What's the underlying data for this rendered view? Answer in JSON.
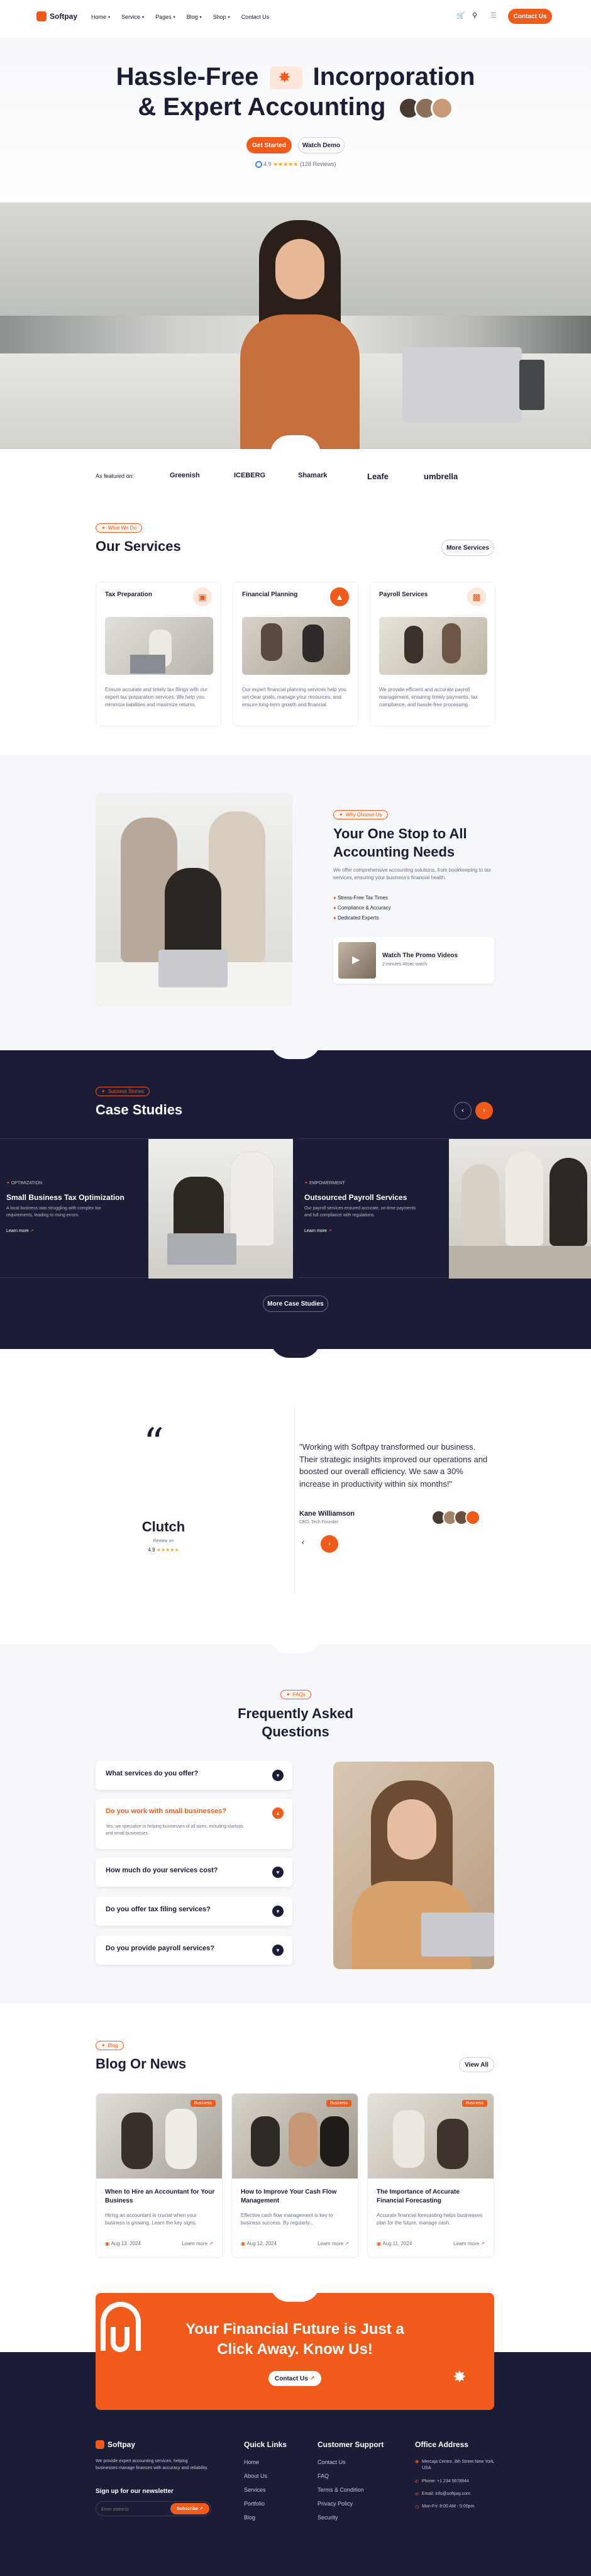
{
  "header": {
    "logo": "Softpay",
    "nav": [
      {
        "label": "Home"
      },
      {
        "label": "Service"
      },
      {
        "label": "Pages"
      },
      {
        "label": "Blog"
      },
      {
        "label": "Shop"
      },
      {
        "label": "Contact Us"
      }
    ],
    "cta": "Contact Us"
  },
  "hero": {
    "title_line1_a": "Hassle-Free",
    "title_line1_b": "Incorporation",
    "title_line2": "& Expert Accounting",
    "primary_btn": "Get Started",
    "secondary_btn": "Watch Demo",
    "rating_value": "4.9",
    "stars": "★★★★★",
    "reviews": "(128 Reviews)"
  },
  "featured": {
    "label": "As featured on:",
    "brands": [
      "Greenish",
      "ICEBERG",
      "Shamark",
      "Leafe",
      "umbrella"
    ]
  },
  "services": {
    "tag": "What We Do",
    "title": "Our Services",
    "more": "More Services",
    "cards": [
      {
        "title": "Tax Preparation",
        "desc": "Ensure accurate and timely tax filings with our expert tax preparation services. We help you minimize liabilities and maximize returns."
      },
      {
        "title": "Financial Planning",
        "desc": "Our expert financial planning services help you set clear goals, manage your resources, and ensure long-term growth and financial."
      },
      {
        "title": "Payroll Services",
        "desc": "We provide efficient and accurate payroll management, ensuring timely payments, tax compliance, and hassle-free processing."
      }
    ]
  },
  "about": {
    "tag": "Why Choose Us",
    "title_line1": "Your One Stop to All",
    "title_line2": "Accounting Needs",
    "desc": "We offer comprehensive accounting solutions, from bookkeeping to tax services, ensuring your business's financial health.",
    "features": [
      "Stress-Free Tax Times",
      "Compliance & Accuracy",
      "Dedicated Experts"
    ],
    "promo_title": "Watch The Promo Videos",
    "promo_sub": "2 minutes 48sec watch"
  },
  "cases": {
    "tag": "Success Stories",
    "title": "Case Studies",
    "items": [
      {
        "category": "OPTIMIZATION",
        "title": "Small Business Tax Optimization",
        "desc": "A local business was struggling with complex tax requirements, leading to rising errors.",
        "link": "Learn more"
      },
      {
        "category": "EMPOWERMENT",
        "title": "Outsourced Payroll Services",
        "desc": "Our payroll services ensured accurate, on-time payments and full compliance with regulations.",
        "link": "Learn more"
      }
    ],
    "more": "More Case Studies"
  },
  "testimonial": {
    "quote": "\"Working with Softpay transformed our business. Their strategic insights improved our operations and boosted our overall efficiency. We saw a 30% increase in productivity within six months!\"",
    "name": "Kane Williamson",
    "role": "CEO, Tech Founder",
    "brand": "Clutch",
    "brand_sub": "Review on",
    "brand_rating": "4.9",
    "brand_stars": "★★★★★"
  },
  "faq": {
    "tag": "FAQs",
    "title_line1": "Frequently Asked",
    "title_line2": "Questions",
    "items": [
      {
        "q": "What services do you offer?"
      },
      {
        "q": "Do you work with small businesses?",
        "a": "Yes, we specialize in helping businesses of all sizes, including startups and small businesses."
      },
      {
        "q": "How much do your services cost?"
      },
      {
        "q": "Do you offer tax filing services?"
      },
      {
        "q": "Do you provide payroll services?"
      }
    ]
  },
  "blog": {
    "tag": "Blog",
    "title": "Blog Or News",
    "view_all": "View All",
    "posts": [
      {
        "badge": "Business",
        "title": "When to Hire an Accountant for Your Business",
        "desc": "Hiring an accountant is crucial when your business is growing. Learn the key signs.",
        "date": "Aug 13, 2024",
        "link": "Learn more"
      },
      {
        "badge": "Business",
        "title": "How to Improve Your Cash Flow Management",
        "desc": "Effective cash flow management is key to business success. By regularly...",
        "date": "Aug 12, 2024",
        "link": "Learn more"
      },
      {
        "badge": "Business",
        "title": "The Importance of Accurate Financial Forecasting",
        "desc": "Accurate financial forecasting helps businesses plan for the future, manage cash.",
        "date": "Aug 11, 2024",
        "link": "Learn more"
      }
    ]
  },
  "cta": {
    "line1": "Your Financial Future is Just a",
    "line2": "Click Away. Know Us!",
    "btn": "Contact Us"
  },
  "footer": {
    "logo": "Softpay",
    "about": "We provide expert accounting services, helping businesses manage finances with accuracy and reliability.",
    "newsletter_title": "Sign up for our newsletter",
    "newsletter_placeholder": "Enter address",
    "newsletter_btn": "Subscribe",
    "quick_title": "Quick Links",
    "quick": [
      "Home",
      "About Us",
      "Services",
      "Portfolio",
      "Blog"
    ],
    "support_title": "Customer Support",
    "support": [
      "Contact Us",
      "FAQ",
      "Terms & Condition",
      "Privacy Policy",
      "Security"
    ],
    "office_title": "Office Address",
    "office": [
      "Mercaja Centre, 8th Street New York, USA",
      "Phone: +1 234 5678944",
      "Email: info@softpay.com",
      "Mon-Fri: 8:00 AM - 5:00pm"
    ]
  },
  "colors": {
    "accent": "#f05a1a",
    "navy": "#1a1d35"
  }
}
